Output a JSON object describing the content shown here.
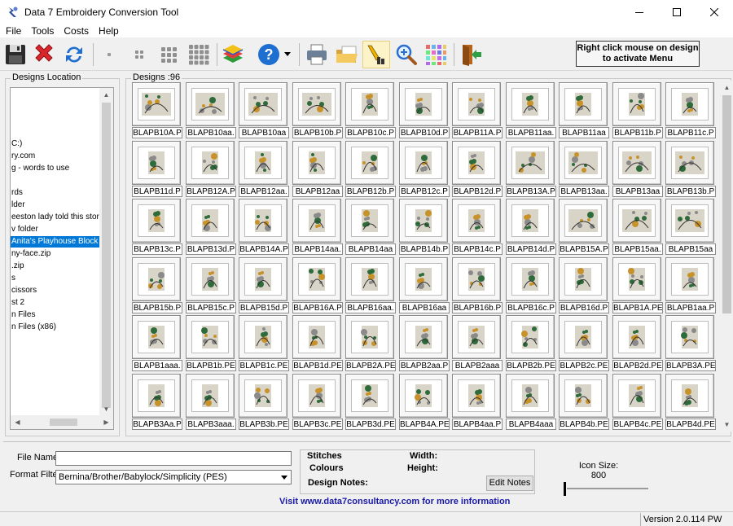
{
  "window": {
    "title": "Data 7 Embroidery Conversion Tool",
    "controls": [
      "minimize-icon",
      "maximize-icon",
      "close-icon"
    ]
  },
  "menu": [
    "File",
    "Tools",
    "Costs",
    "Help"
  ],
  "toolbar": {
    "items": [
      {
        "name": "save-icon"
      },
      {
        "name": "delete-icon"
      },
      {
        "name": "refresh-icon"
      },
      {
        "name": "sep"
      },
      {
        "name": "size-1-icon"
      },
      {
        "name": "size-4-icon"
      },
      {
        "name": "size-9-icon"
      },
      {
        "name": "size-16-icon"
      },
      {
        "name": "sep"
      },
      {
        "name": "layers-icon"
      },
      {
        "name": "help-icon"
      },
      {
        "name": "sep"
      },
      {
        "name": "print-icon"
      },
      {
        "name": "open-folder-icon"
      },
      {
        "name": "pencil-ruler-icon"
      },
      {
        "name": "zoom-icon"
      },
      {
        "name": "palette-grid-icon"
      },
      {
        "name": "sep"
      },
      {
        "name": "exit-door-icon"
      }
    ],
    "right_click_note": "Right click mouse on design to activate Menu"
  },
  "designs_location": {
    "label": "Designs Location",
    "items": [
      {
        "text": "C:)",
        "selected": false
      },
      {
        "text": "ry.com",
        "selected": false
      },
      {
        "text": "g - words to use",
        "selected": false
      },
      {
        "text": "",
        "selected": false
      },
      {
        "text": "rds",
        "selected": false
      },
      {
        "text": "lder",
        "selected": false
      },
      {
        "text": "eeston lady told this stor",
        "selected": false
      },
      {
        "text": "v folder",
        "selected": false
      },
      {
        "text": " Anita's Playhouse Block",
        "selected": true
      },
      {
        "text": "ny-face.zip",
        "selected": false
      },
      {
        "text": ".zip",
        "selected": false
      },
      {
        "text": "s",
        "selected": false
      },
      {
        "text": "cissors",
        "selected": false
      },
      {
        "text": "st 2",
        "selected": false
      },
      {
        "text": "n Files",
        "selected": false
      },
      {
        "text": "n Files (x86)",
        "selected": false
      }
    ]
  },
  "designs": {
    "label": "Designs :96",
    "items": [
      "BLAPB10A.P",
      "BLAPB10aa.",
      "BLAPB10aa",
      "BLAPB10b.P",
      "BLAPB10c.P",
      "BLAPB10d.P",
      "BLAPB11A.P",
      "BLAPB11aa.",
      "BLAPB11aa",
      "BLAPB11b.P",
      "BLAPB11c.P",
      "BLAPB11d.P",
      "BLAPB12A.P",
      "BLAPB12aa.",
      "BLAPB12aa",
      "BLAPB12b.P",
      "BLAPB12c.P",
      "BLAPB12d.P",
      "BLAPB13A.P",
      "BLAPB13aa.",
      "BLAPB13aa",
      "BLAPB13b.P",
      "BLAPB13c.P",
      "BLAPB13d.P",
      "BLAPB14A.P",
      "BLAPB14aa.",
      "BLAPB14aa",
      "BLAPB14b.P",
      "BLAPB14c.P",
      "BLAPB14d.P",
      "BLAPB15A.P",
      "BLAPB15aa.",
      "BLAPB15aa",
      "BLAPB15b.P",
      "BLAPB15c.P",
      "BLAPB15d.P",
      "BLAPB16A.P",
      "BLAPB16aa.",
      "BLAPB16aa",
      "BLAPB16b.P",
      "BLAPB16c.P",
      "BLAPB16d.P",
      "BLAPB1A.PE",
      "BLAPB1aa.P",
      "BLAPB1aaa.",
      "BLAPB1b.PE",
      "BLAPB1c.PE",
      "BLAPB1d.PE",
      "BLAPB2A.PE",
      "BLAPB2aa.P",
      "BLAPB2aaa",
      "BLAPB2b.PE",
      "BLAPB2c.PE",
      "BLAPB2d.PE",
      "BLAPB3A.PE",
      "BLAPB3Aa.P",
      "BLAPB3aaa.",
      "BLAPB3b.PE",
      "BLAPB3c.PE",
      "BLAPB3d.PE",
      "BLAPB4A.PE",
      "BLAPB4aa.P",
      "BLAPB4aaa",
      "BLAPB4b.PE",
      "BLAPB4c.PE",
      "BLAPB4d.PE"
    ]
  },
  "bottom": {
    "file_name_label": "File Name",
    "file_name_value": "",
    "format_filter_label": "Format Filter",
    "format_filter_value": "Bernina/Brother/Babylock/Simplicity (PES)",
    "stitches_label": "Stitches",
    "colours_label": "Colours",
    "width_label": "Width:",
    "height_label": "Height:",
    "design_notes_label": "Design Notes:",
    "edit_notes_label": "Edit Notes",
    "visit_text": "Visit www.data7consultancy.com for more information",
    "icon_size_label": "Icon Size:",
    "icon_size_value": "800"
  },
  "status": {
    "version": "Version 2.0.114 PW"
  },
  "colors": {
    "selection": "#0078d7",
    "link_text": "#1a1aa6",
    "stitch_green": "#2e6b3a",
    "stitch_gold": "#c8922a",
    "stitch_grey": "#8a8a8a"
  }
}
